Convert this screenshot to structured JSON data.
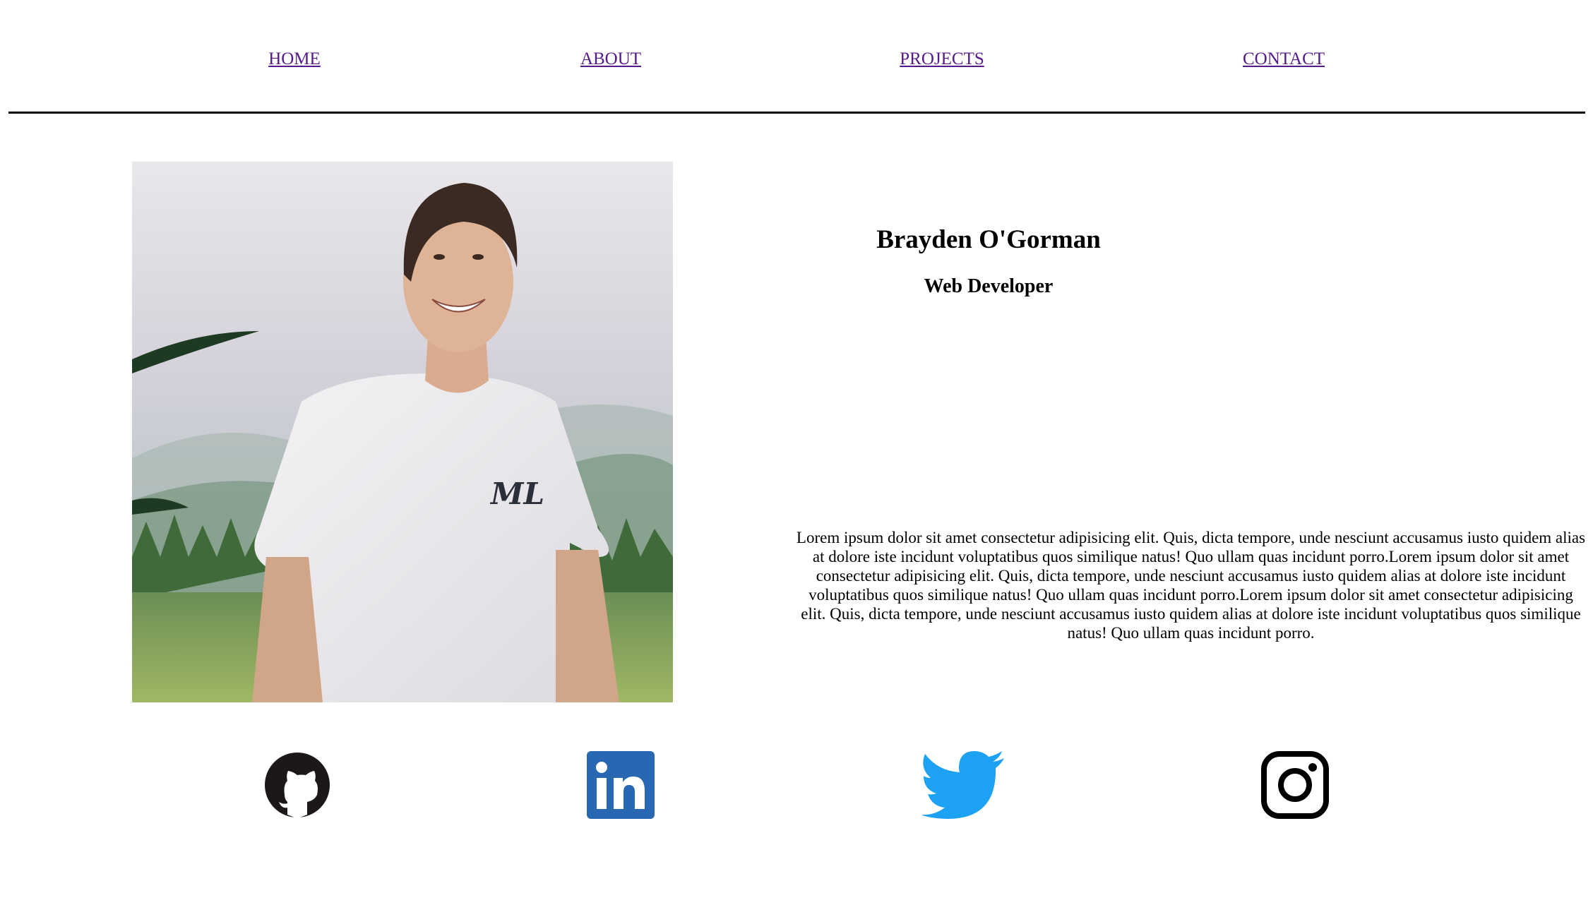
{
  "nav": {
    "items": [
      {
        "label": "HOME"
      },
      {
        "label": "ABOUT"
      },
      {
        "label": "PROJECTS"
      },
      {
        "label": "CONTACT"
      }
    ]
  },
  "profile": {
    "photo_alt": "Profile photo",
    "shirt_text": "ML"
  },
  "hero": {
    "name": "Brayden O'Gorman",
    "title": "Web Developer",
    "bio": "Lorem ipsum dolor sit amet consectetur adipisicing elit. Quis, dicta tempore, unde nesciunt accusamus iusto quidem alias at dolore iste incidunt voluptatibus quos similique natus! Quo ullam quas incidunt porro.Lorem ipsum dolor sit amet consectetur adipisicing elit. Quis, dicta tempore, unde nesciunt accusamus iusto quidem alias at dolore iste incidunt voluptatibus quos similique natus! Quo ullam quas incidunt porro.Lorem ipsum dolor sit amet consectetur adipisicing elit. Quis, dicta tempore, unde nesciunt accusamus iusto quidem alias at dolore iste incidunt voluptatibus quos similique natus! Quo ullam quas incidunt porro."
  },
  "social": [
    {
      "icon": "github-icon",
      "color": "#1b1817"
    },
    {
      "icon": "linkedin-icon",
      "color": "#2867b2"
    },
    {
      "icon": "twitter-icon",
      "color": "#1da1f2"
    },
    {
      "icon": "instagram-icon",
      "color": "#000000"
    }
  ],
  "colors": {
    "link": "#551a8b",
    "rule": "#000000"
  }
}
